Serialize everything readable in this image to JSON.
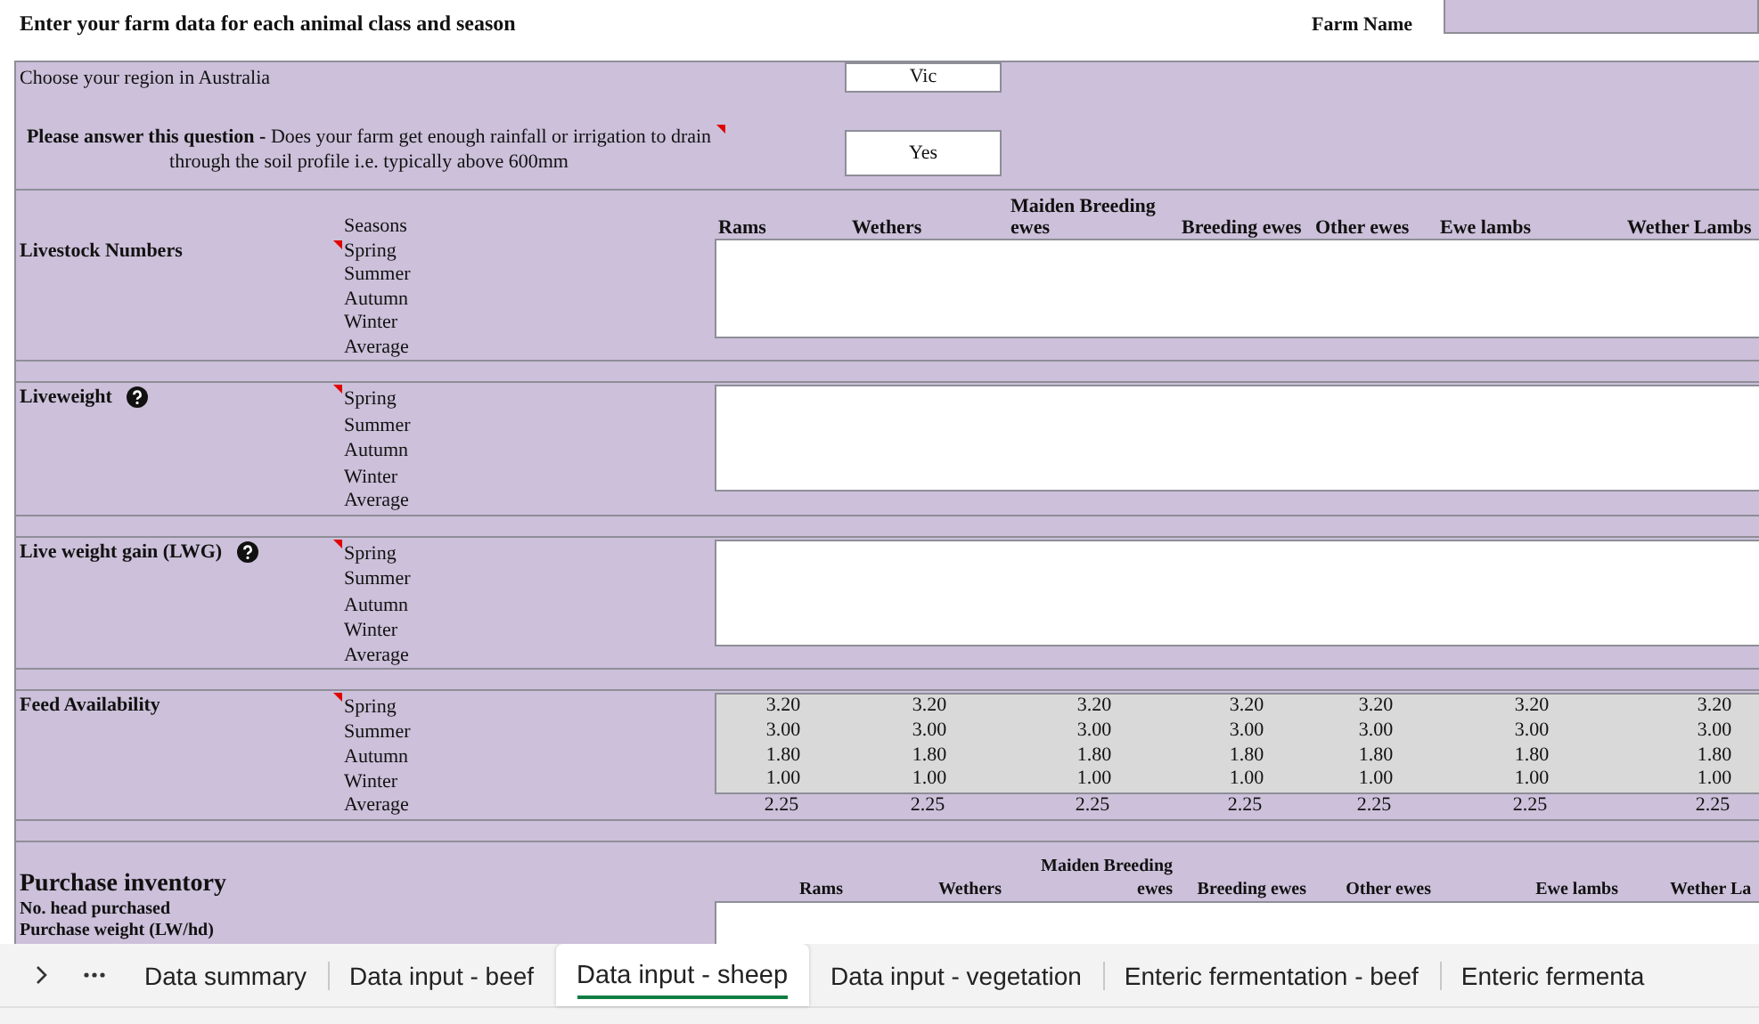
{
  "header": {
    "title": "Enter your farm data for each animal class and season",
    "farm_name_label": "Farm Name"
  },
  "region": {
    "label": "Choose your region in Australia",
    "value": "Vic"
  },
  "question": {
    "text": "**Please answer this question -** Does your farm get enough rainfall or irrigation to drain through the soil profile i.e. typically above 600mm",
    "value": "Yes",
    "comment": true
  },
  "sections": [
    {
      "kind": "input",
      "title": "Livestock Numbers",
      "help": false,
      "comment": true,
      "seasons_header": "Seasons",
      "columns": [
        "Rams",
        "Wethers",
        "Maiden Breeding ewes",
        "Breeding ewes",
        "Other ewes",
        "Ewe lambs",
        "Wether Lambs"
      ],
      "seasons": [
        "Spring",
        "Summer",
        "Autumn",
        "Winter"
      ],
      "average": "Average"
    },
    {
      "kind": "input",
      "title": "Liveweight",
      "help": true,
      "comment": true,
      "seasons": [
        "Spring",
        "Summer",
        "Autumn",
        "Winter"
      ],
      "average": "Average"
    },
    {
      "kind": "input",
      "title": "Live weight gain (LWG)",
      "help": true,
      "comment": true,
      "seasons": [
        "Spring",
        "Summer",
        "Autumn",
        "Winter"
      ],
      "average": "Average"
    },
    {
      "kind": "computed",
      "title": "Feed Availability",
      "help": false,
      "comment": true,
      "rows": [
        {
          "season": "Spring",
          "values": [
            "3.20",
            "3.20",
            "3.20",
            "3.20",
            "3.20",
            "3.20",
            "3.20"
          ]
        },
        {
          "season": "Summer",
          "values": [
            "3.00",
            "3.00",
            "3.00",
            "3.00",
            "3.00",
            "3.00",
            "3.00"
          ]
        },
        {
          "season": "Autumn",
          "values": [
            "1.80",
            "1.80",
            "1.80",
            "1.80",
            "1.80",
            "1.80",
            "1.80"
          ]
        },
        {
          "season": "Winter",
          "values": [
            "1.00",
            "1.00",
            "1.00",
            "1.00",
            "1.00",
            "1.00",
            "1.00"
          ]
        }
      ],
      "average": {
        "label": "Average",
        "values": [
          "2.25",
          "2.25",
          "2.25",
          "2.25",
          "2.25",
          "2.25",
          "2.25"
        ]
      }
    }
  ],
  "purchase": {
    "title": "Purchase inventory",
    "items": [
      "No. head purchased",
      "Purchase weight (LW/hd)"
    ],
    "columns": [
      "Rams",
      "Wethers",
      "Maiden Breeding ewes",
      "Breeding ewes",
      "Other ewes",
      "Ewe lambs",
      "Wether La"
    ]
  },
  "tabs": [
    {
      "label": "Data summary",
      "selected": false
    },
    {
      "label": "Data input - beef",
      "selected": false
    },
    {
      "label": "Data input - sheep",
      "selected": true
    },
    {
      "label": "Data input - vegetation",
      "selected": false
    },
    {
      "label": "Enteric fermentation - beef",
      "selected": false
    },
    {
      "label": "Enteric fermenta",
      "selected": false
    }
  ]
}
